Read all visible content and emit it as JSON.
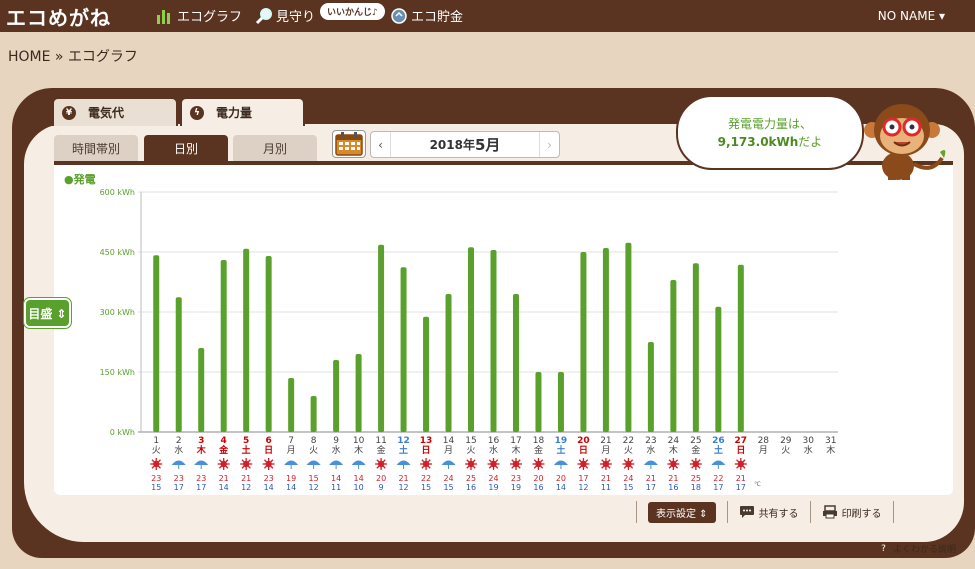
{
  "app": {
    "logo": "エコめがね",
    "nav": [
      {
        "label": "エコグラフ",
        "icon": "bar-chart-icon"
      },
      {
        "label": "見守り",
        "icon": "magnifier-icon"
      },
      {
        "label": "エコ貯金",
        "icon": "coin-icon"
      }
    ],
    "badge": "いいかんじ♪",
    "user": "NO NAME ▾"
  },
  "breadcrumb": "HOME » エコグラフ",
  "tabs": {
    "cost": {
      "label": "電気代",
      "icon": "yen-icon"
    },
    "power": {
      "label": "電力量",
      "icon": "power-icon"
    }
  },
  "subtabs": {
    "hour": "時間帯別",
    "day": "日別",
    "month": "月別"
  },
  "date_nav": {
    "prev": "‹",
    "next": "›",
    "year": "2018年",
    "month": "5月"
  },
  "bubble": {
    "line1": "発電電力量は、",
    "amount": "9,173.0kWh",
    "suffix": "だよ"
  },
  "scale_button": "目盛 ⇕",
  "legend": "●発電",
  "bottom": {
    "display_setting": "表示設定 ⇕",
    "share": "共有する",
    "print": "印刷する"
  },
  "help": "よくわかる説明",
  "colors": {
    "brown": "#5a3420",
    "green": "#5aa02c",
    "sunday": "#cc0000",
    "saturday": "#3a7fd0"
  },
  "chart_data": {
    "type": "bar",
    "ylabel": "",
    "ylim": [
      0,
      600
    ],
    "yticks": [
      "0 kWh",
      "150 kWh",
      "300 kWh",
      "450 kWh",
      "600 kWh"
    ],
    "categories": [
      "1",
      "2",
      "3",
      "4",
      "5",
      "6",
      "7",
      "8",
      "9",
      "10",
      "11",
      "12",
      "13",
      "14",
      "15",
      "16",
      "17",
      "18",
      "19",
      "20",
      "21",
      "22",
      "23",
      "24",
      "25",
      "26",
      "27",
      "28",
      "29",
      "30",
      "31"
    ],
    "weekdays": [
      "火",
      "水",
      "木",
      "金",
      "土",
      "日",
      "月",
      "火",
      "水",
      "木",
      "金",
      "土",
      "日",
      "月",
      "火",
      "水",
      "木",
      "金",
      "土",
      "日",
      "月",
      "火",
      "水",
      "木",
      "金",
      "土",
      "日",
      "月",
      "火",
      "水",
      "木"
    ],
    "day_type": [
      "",
      "",
      "holiday",
      "holiday",
      "holiday",
      "sun",
      "",
      "",
      "",
      "",
      "",
      "sat",
      "sun",
      "",
      "",
      "",
      "",
      "",
      "sat",
      "sun",
      "",
      "",
      "",
      "",
      "",
      "sat",
      "sun",
      "",
      "",
      "",
      ""
    ],
    "series": [
      {
        "name": "発電",
        "values": [
          442,
          337,
          210,
          430,
          458,
          440,
          135,
          90,
          180,
          195,
          468,
          412,
          288,
          345,
          462,
          455,
          345,
          150,
          150,
          450,
          460,
          473,
          225,
          380,
          422,
          313,
          418,
          null,
          null,
          null,
          null
        ]
      }
    ],
    "weather": [
      "sun",
      "umbrella",
      "umbrella",
      "sun",
      "sun",
      "sun",
      "umbrella",
      "umbrella",
      "umbrella",
      "umbrella",
      "sun",
      "umbrella",
      "sun",
      "umbrella",
      "sun",
      "sun",
      "sun",
      "sun",
      "umbrella",
      "sun",
      "sun",
      "sun",
      "umbrella",
      "sun",
      "sun",
      "umbrella",
      "sun",
      null,
      null,
      null,
      null
    ],
    "temp_high": [
      "23",
      "23",
      "23",
      "21",
      "21",
      "23",
      "19",
      "15",
      "14",
      "14",
      "20",
      "21",
      "22",
      "24",
      "25",
      "24",
      "23",
      "20",
      "20",
      "17",
      "21",
      "24",
      "21",
      "21",
      "25",
      "22",
      "21",
      null,
      null,
      null,
      null
    ],
    "temp_low": [
      "15",
      "17",
      "17",
      "14",
      "12",
      "14",
      "14",
      "12",
      "11",
      "10",
      "9",
      "12",
      "15",
      "15",
      "16",
      "19",
      "19",
      "16",
      "14",
      "12",
      "11",
      "15",
      "17",
      "16",
      "18",
      "17",
      "17",
      null,
      null,
      null,
      null
    ],
    "temp_unit": "℃"
  }
}
